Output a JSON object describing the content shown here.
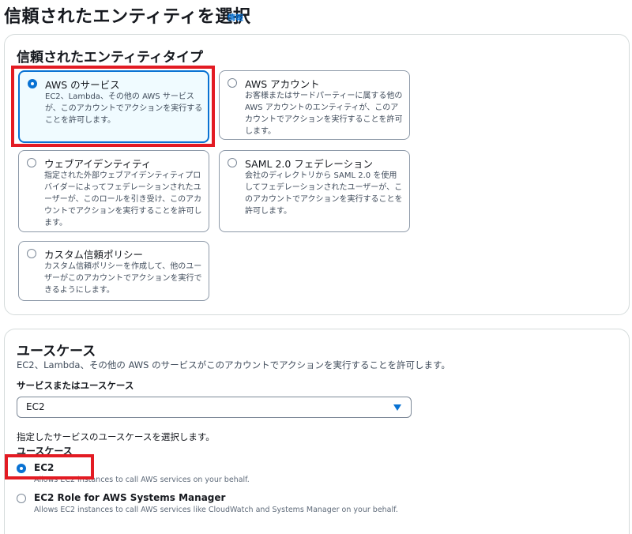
{
  "page": {
    "title": "信頼されたエンティティを選択",
    "info_link": "情報"
  },
  "entity_section": {
    "title": "信頼されたエンティティタイプ",
    "options": [
      {
        "title": "AWS のサービス",
        "description": "EC2、Lambda、その他の AWS サービスが、このアカウントでアクションを実行することを許可します。",
        "selected": true
      },
      {
        "title": "AWS アカウント",
        "description": "お客様またはサードパーティーに属する他の AWS アカウントのエンティティが、このアカウントでアクションを実行することを許可します。",
        "selected": false
      },
      {
        "title": "ウェブアイデンティティ",
        "description": "指定された外部ウェブアイデンティティプロバイダーによってフェデレーションされたユーザーが、このロールを引き受け、このアカウントでアクションを実行することを許可します。",
        "selected": false
      },
      {
        "title": "SAML 2.0 フェデレーション",
        "description": "会社のディレクトリから SAML 2.0 を使用してフェデレーションされたユーザーが、このアカウントでアクションを実行することを許可します。",
        "selected": false
      },
      {
        "title": "カスタム信頼ポリシー",
        "description": "カスタム信頼ポリシーを作成して、他のユーザーがこのアカウントでアクションを実行できるようにします。",
        "selected": false
      }
    ]
  },
  "usecase_section": {
    "title": "ユースケース",
    "description": "EC2、Lambda、その他の AWS のサービスがこのアカウントでアクションを実行することを許可します。",
    "service_label": "サービスまたはユースケース",
    "service_value": "EC2",
    "choose_text": "指定したサービスのユースケースを選択します。",
    "usecase_label": "ユースケース",
    "options": [
      {
        "title": "EC2",
        "description": "Allows EC2 instances to call AWS services on your behalf.",
        "selected": true
      },
      {
        "title": "EC2 Role for AWS Systems Manager",
        "description": "Allows EC2 instances to call AWS services like CloudWatch and Systems Manager on your behalf.",
        "selected": false
      }
    ]
  },
  "colors": {
    "accent": "#0972d3",
    "highlight": "#e31b23",
    "selected_bg": "#f0fbff"
  }
}
